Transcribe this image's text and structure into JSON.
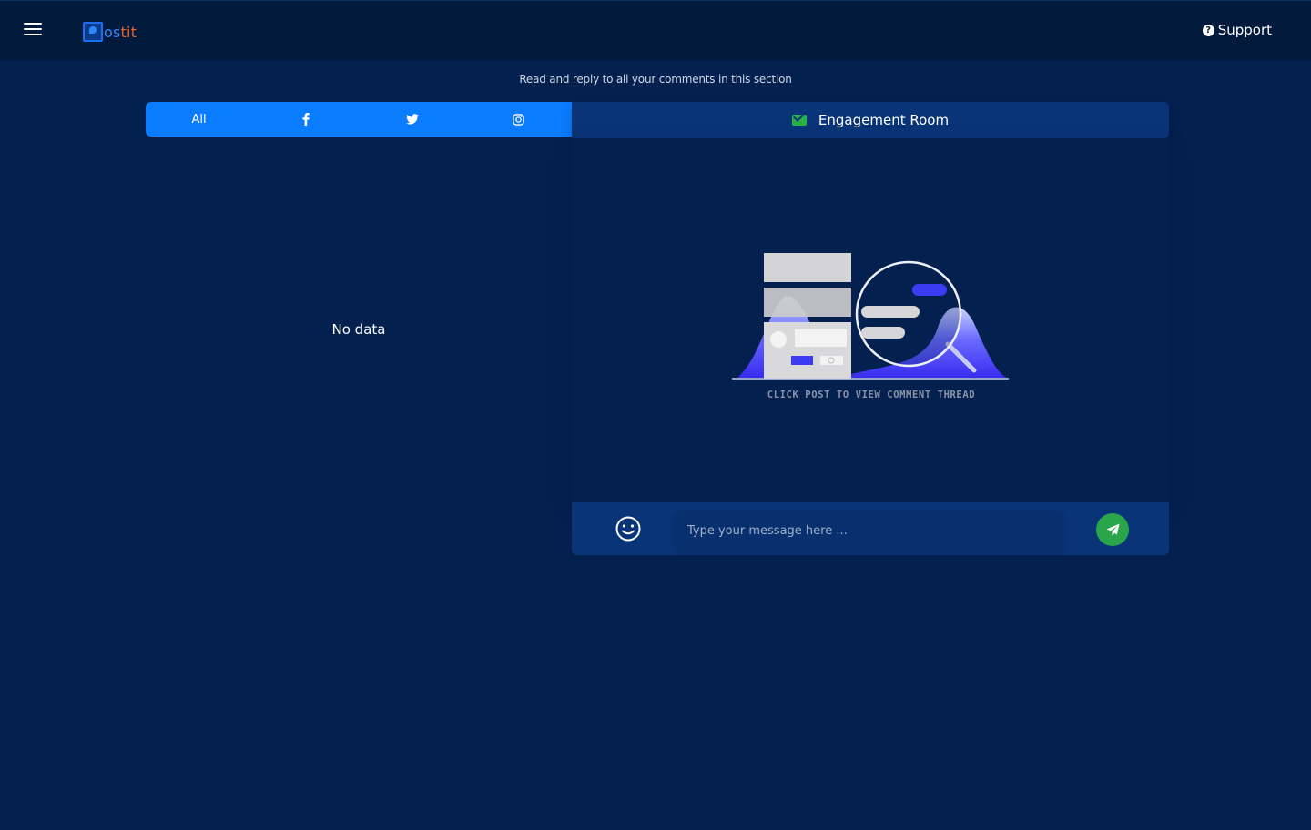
{
  "topbar": {
    "logo_text_a": "ostit",
    "support_label": "Support"
  },
  "subtitle": "Read and reply to all your comments in this section",
  "filters": {
    "all_label": "All"
  },
  "engagement": {
    "title": "Engagement Room",
    "caption": "CLICK POST TO VIEW COMMENT THREAD"
  },
  "list": {
    "empty_text": "No data"
  },
  "composer": {
    "placeholder": "Type your message here ..."
  },
  "colors": {
    "background": "#03204f",
    "topbar": "#021a3b",
    "accent": "#0a7cff",
    "send": "#2aa64a",
    "mail_icon": "#27b24a"
  }
}
